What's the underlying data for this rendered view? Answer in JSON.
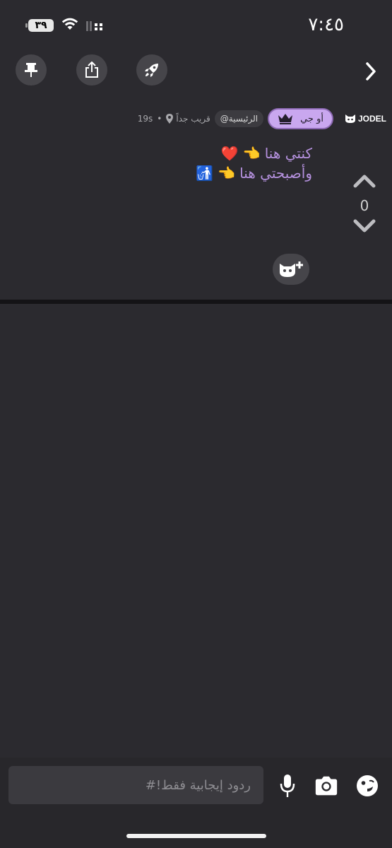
{
  "status_bar": {
    "time": "٧:٤٥",
    "battery_level": "٣٩"
  },
  "toolbar": {
    "buttons": [
      "pin-icon",
      "share-icon",
      "rocket-icon"
    ],
    "next_icon": "chevron-right-icon"
  },
  "post": {
    "brand": "JODEL",
    "user_badge": "أو جي",
    "channel": "@الرئيسية",
    "location": "قريب جداً",
    "separator": "•",
    "age": "19s",
    "text_line_1": "كنتي هنا",
    "text_line_2": "وأصبحتي هنا",
    "vote_count": "0",
    "text_color": "#b591de",
    "badge_color": "#c9a7ef"
  },
  "reply_bar": {
    "placeholder": "ردود إيجابية فقط!#",
    "icons": [
      "microphone-icon",
      "camera-icon",
      "sticker-icon"
    ]
  }
}
